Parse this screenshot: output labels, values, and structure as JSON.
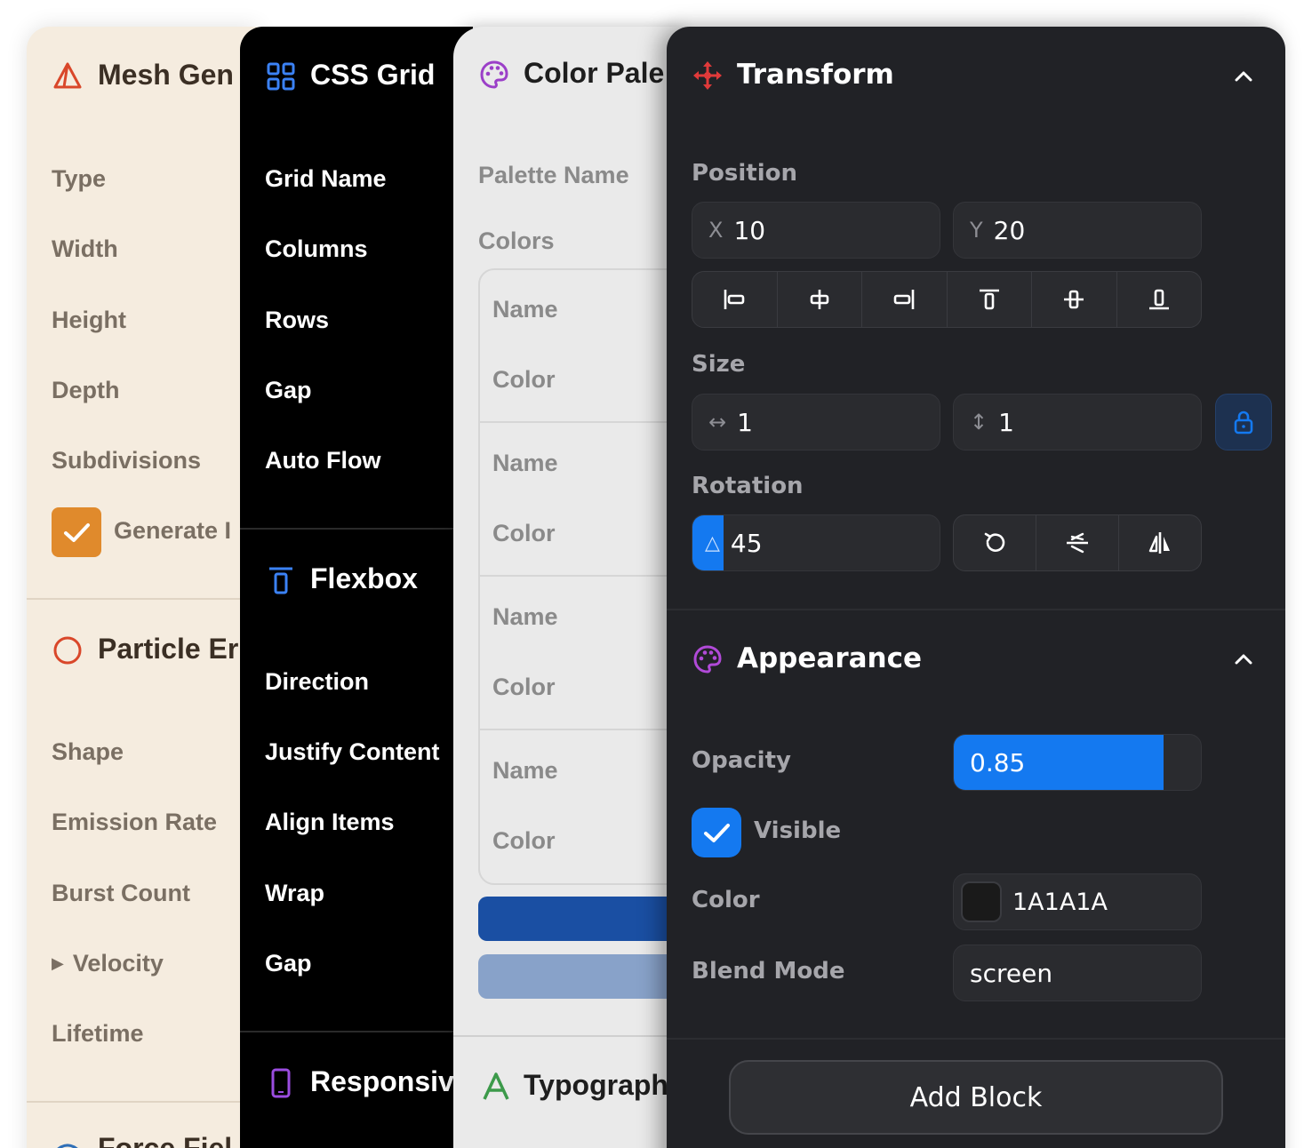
{
  "mesh_panel": {
    "title": "Mesh Gen",
    "fields": [
      "Type",
      "Width",
      "Height",
      "Depth",
      "Subdivisions"
    ],
    "checkbox_label": "Generate I",
    "checkbox_checked": true,
    "particle_title": "Particle Er",
    "particle_fields": [
      "Shape",
      "Emission Rate",
      "Burst Count"
    ],
    "velocity_label": "Velocity",
    "lifetime_label": "Lifetime",
    "force_title": "Force Fiel",
    "accent_color": "#e08a2c"
  },
  "css_grid_panel": {
    "title": "CSS Grid",
    "fields": [
      "Grid Name",
      "Columns",
      "Rows",
      "Gap",
      "Auto Flow"
    ],
    "flexbox_title": "Flexbox",
    "flexbox_fields": [
      "Direction",
      "Justify Content",
      "Align Items",
      "Wrap",
      "Gap"
    ],
    "responsive_title": "Responsiv"
  },
  "color_palette_panel": {
    "title": "Color Pale",
    "palette_name_label": "Palette Name",
    "colors_label": "Colors",
    "color_entries": [
      {
        "name_label": "Name",
        "color_label": "Color"
      },
      {
        "name_label": "Name",
        "color_label": "Color"
      },
      {
        "name_label": "Name",
        "color_label": "Color"
      },
      {
        "name_label": "Name",
        "color_label": "Color"
      }
    ],
    "typography_title": "Typograph"
  },
  "transform_panel": {
    "title": "Transform",
    "position_label": "Position",
    "x_prefix": "X",
    "x_value": "10",
    "y_prefix": "Y",
    "y_value": "20",
    "align_icons": [
      "align-left-icon",
      "align-center-horizontal-icon",
      "align-right-icon",
      "align-top-icon",
      "align-middle-vertical-icon",
      "align-bottom-icon"
    ],
    "size_label": "Size",
    "width_value": "1",
    "height_value": "1",
    "rotation_label": "Rotation",
    "rotation_value": "45",
    "rotation_icons": [
      "rotate-icon",
      "flip-vertical-icon",
      "flip-horizontal-icon"
    ]
  },
  "appearance_panel": {
    "title": "Appearance",
    "opacity_label": "Opacity",
    "opacity_value": "0.85",
    "opacity_fraction": 0.85,
    "visible_label": "Visible",
    "visible_checked": true,
    "color_label": "Color",
    "color_value": "1A1A1A",
    "blend_mode_label": "Blend Mode",
    "blend_mode_value": "screen",
    "add_block_label": "Add Block",
    "accent_color": "#1479f0"
  }
}
